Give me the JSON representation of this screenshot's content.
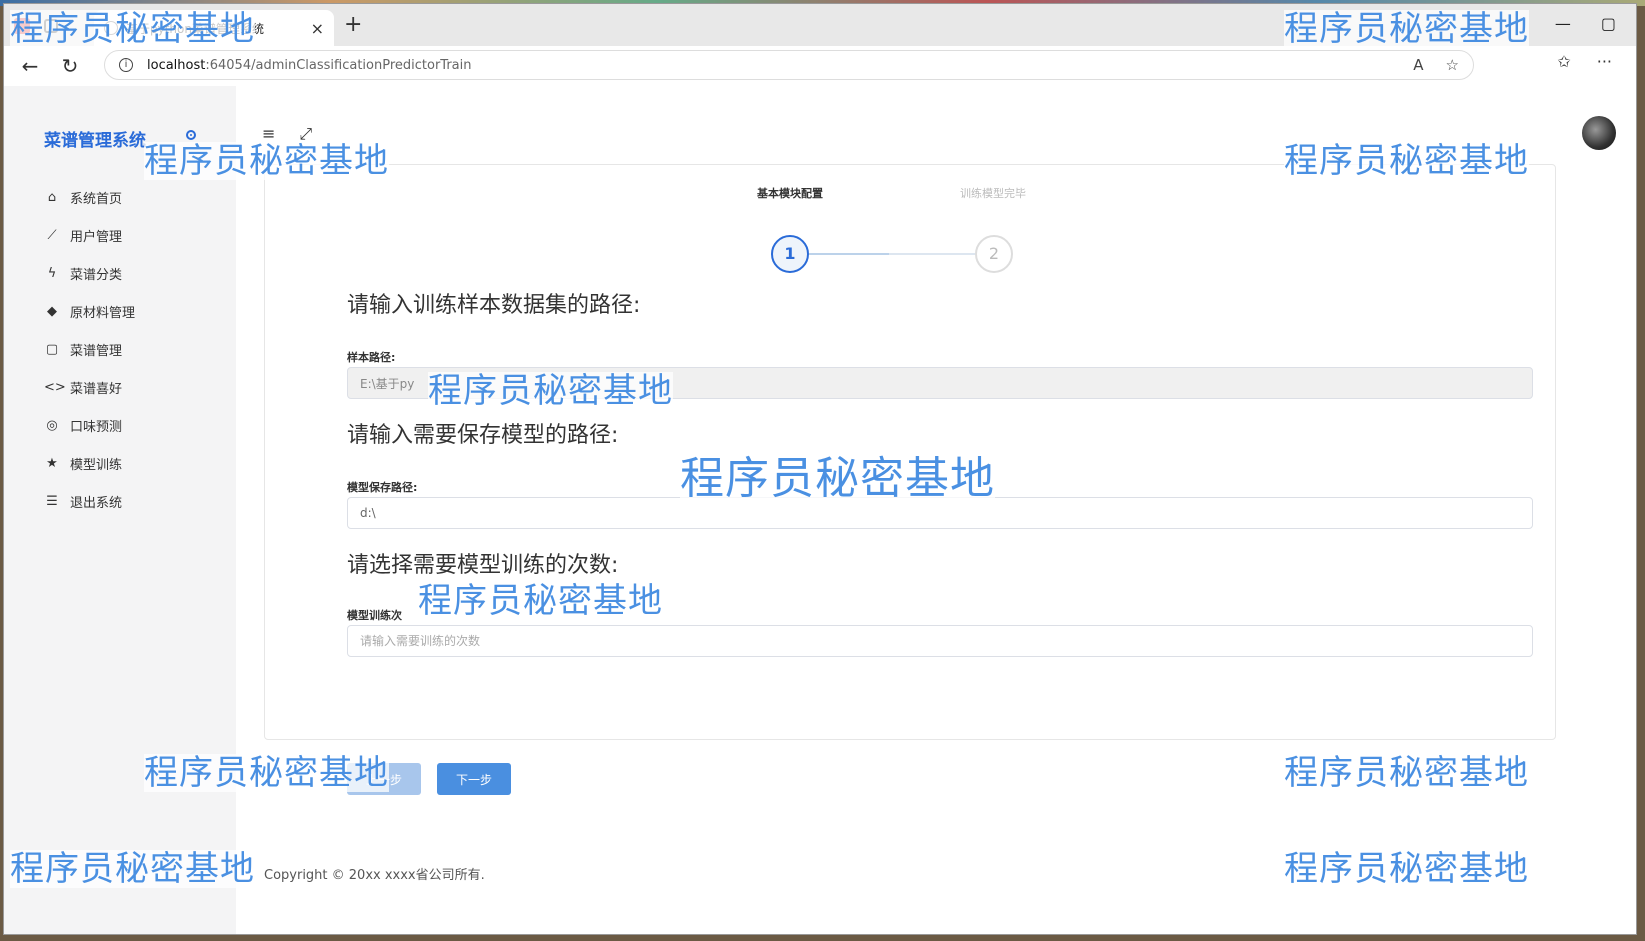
{
  "browser": {
    "tab_title": "基于python菜谱管理系统",
    "tab_close": "×",
    "new_tab": "+",
    "url_host": "localhost",
    "url_path": ":64054/adminClassificationPredictorTrain",
    "controls": {
      "minimize": "—",
      "maximize": "▢"
    }
  },
  "sidebar": {
    "brand": "菜谱管理系统",
    "items": [
      {
        "icon": "home-icon",
        "glyph": "⌂",
        "label": "系统首页"
      },
      {
        "icon": "line-chart-icon",
        "glyph": "⟋",
        "label": "用户管理"
      },
      {
        "icon": "bolt-icon",
        "glyph": "ϟ",
        "label": "菜谱分类"
      },
      {
        "icon": "layers-icon",
        "glyph": "◆",
        "label": "原材料管理"
      },
      {
        "icon": "square-icon",
        "glyph": "▢",
        "label": "菜谱管理"
      },
      {
        "icon": "code-icon",
        "glyph": "<>",
        "label": "菜谱喜好"
      },
      {
        "icon": "target-icon",
        "glyph": "◎",
        "label": "口味预测"
      },
      {
        "icon": "star-icon",
        "glyph": "★",
        "label": "模型训练"
      },
      {
        "icon": "list-icon",
        "glyph": "☰",
        "label": "退出系统"
      }
    ]
  },
  "steps": [
    {
      "label": "基本模块配置",
      "number": "1",
      "state": "active"
    },
    {
      "label": "训练模型完毕",
      "number": "2",
      "state": "pending"
    }
  ],
  "form": {
    "sample_section_title": "请输入训练样本数据集的路径:",
    "sample_label": "样本路径:",
    "sample_value": "E:\\基于py",
    "model_section_title": "请输入需要保存模型的路径:",
    "model_label": "模型保存路径:",
    "model_value": "d:\\",
    "epochs_section_title": "请选择需要模型训练的次数:",
    "epochs_label": "模型训练次",
    "epochs_placeholder": "请输入需要训练的次数",
    "prev_button": "上一步",
    "next_button": "下一步"
  },
  "footer": {
    "copyright": "Copyright © 20xx xxxx省公司所有."
  },
  "watermark": {
    "text": "程序员秘密基地"
  },
  "colors": {
    "accent": "#2a6bd8",
    "button_primary": "#4a8fe0",
    "button_disabled": "#a8c6ec",
    "watermark": "#4a90e2"
  }
}
